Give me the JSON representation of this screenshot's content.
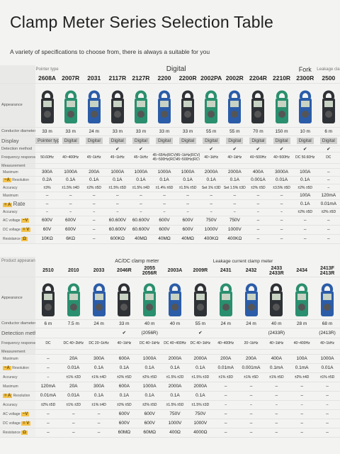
{
  "title": "Clamp Meter Series Selection Table",
  "subtitle": "A variety of specifications to choose from, there is always a suitable for you",
  "p1": {
    "pointer_type": "Pointer type",
    "digital": "Digital",
    "fork": "Fork",
    "fork_note": "Leakage clamp meter",
    "models": [
      "2608A",
      "2007R",
      "2031",
      "2117R",
      "2127R",
      "2200",
      "2200R",
      "2002PA",
      "2002R",
      "2204R",
      "2210R",
      "2300R",
      "2500"
    ],
    "labels": {
      "appearance": "Appearance",
      "conductor": "Conductor diameter",
      "display": "Display",
      "detection": "Detection method",
      "frequency": "Frequency response",
      "measurement": "Measurement",
      "maximum": "Maximum",
      "resolution": "Resolution",
      "accuracy": "Accuracy",
      "maximum2": "Maximum",
      "rate": "Rate",
      "accuracy2": "Accuracy",
      "ac_voltage": "AC voltage",
      "dc_voltage": "DC voltage",
      "resistance": "Resistance",
      "va": "~V",
      "vd": "= V",
      "ohm": "Ω",
      "aa": "~A",
      "ad": "= A"
    },
    "conductor": [
      "33 m",
      "33 m",
      "24 m",
      "33 m",
      "33 m",
      "33 m",
      "33 m",
      "55 m",
      "55 m",
      "70 m",
      "150 m",
      "10 m",
      "6 m"
    ],
    "display": [
      "Pointer type",
      "Digital",
      "Digital",
      "Digital",
      "Digital",
      "Digital",
      "Digital",
      "Digital",
      "Digital",
      "Digital",
      "Digital",
      "Digital",
      "Digital"
    ],
    "detection": [
      "",
      "",
      "",
      "✔",
      "✔",
      "",
      "",
      "✔",
      "✔",
      "✔",
      "✔",
      "✔",
      "✔"
    ],
    "frequency": [
      "50.60Hz",
      "40~400Hz",
      "45~1kHz",
      "45~1kHz",
      "45~1kHz",
      "45~65Hz(RCV) 45~500Hz(RCV)",
      "45~1kHz(RCV) 45~500Hz(RCV)",
      "40~1kHz",
      "40~1kHz",
      "40~500Hz",
      "40~500Hz",
      "DC 50.60Hz",
      "DC"
    ],
    "aac_max": [
      "300A",
      "1000A",
      "200A",
      "1000A",
      "1000A",
      "1000A",
      "1000A",
      "2000A",
      "2000A",
      "400A",
      "3000A",
      "100A",
      "–"
    ],
    "aac_res": [
      "0.2A",
      "0.1A",
      "0.1A",
      "0.1A",
      "0.1A",
      "0.1A",
      "0.1A",
      "0.1A",
      "0.1A",
      "0.001A",
      "0.01A",
      "0.1A",
      "–"
    ],
    "aac_acc": [
      "±3%",
      "±1.5% ±4D",
      "±2% ±5D",
      "±1.5% ±5D",
      "±1.5% ±4D",
      "±1.4% ±6D",
      "±1.5% ±5D",
      "Set 1% ±3D",
      "Set 1.5% ±3D",
      "±2% ±5D",
      "±3.5% ±5D",
      "±2% ±5D",
      "–"
    ],
    "adc_max": [
      "–",
      "–",
      "–",
      "–",
      "–",
      "–",
      "–",
      "–",
      "–",
      "–",
      "–",
      "100A",
      "120mA"
    ],
    "adc_res": [
      "–",
      "–",
      "–",
      "–",
      "–",
      "–",
      "–",
      "–",
      "–",
      "–",
      "–",
      "0.1A",
      "0.01mA"
    ],
    "adc_acc": [
      "–",
      "–",
      "–",
      "–",
      "–",
      "–",
      "–",
      "–",
      "–",
      "–",
      "–",
      "±2% ±5D",
      "±2% ±5D"
    ],
    "vac": [
      "600V",
      "600V",
      "–",
      "60.600V",
      "60.600V",
      "600V",
      "600V",
      "750V",
      "750V",
      "–",
      "–",
      "–",
      "–"
    ],
    "vdc": [
      "60V",
      "600V",
      "–",
      "60.600V",
      "60.600V",
      "600V",
      "600V",
      "1000V",
      "1000V",
      "–",
      "–",
      "–",
      "–"
    ],
    "res": [
      "10KΩ",
      "6KΩ",
      "–",
      "600KΩ",
      "40MΩ",
      "40MΩ",
      "40MΩ",
      "400KΩ",
      "400KΩ",
      "–",
      "–",
      "–",
      "–"
    ]
  },
  "p2": {
    "product": "Product appearance",
    "acdc": "AC/DC clamp meter",
    "leak": "Leakage current clamp meter",
    "models": [
      "2510",
      "2010",
      "2033",
      "2046R",
      "2055 2056R",
      "2003A",
      "2009R",
      "2431",
      "2432",
      "2433 2433R",
      "2434",
      "2413F 2413R"
    ],
    "labels": {
      "appearance": "Appearance",
      "conductor": "Conductor diameter",
      "detection": "Detection method",
      "frequency": "Frequency response",
      "measurement": "Measurement",
      "maximum": "Maximum",
      "resolution": "Resolution",
      "accuracy": "Accuracy",
      "maximum2": "Maximum",
      "resolution2": "Resolution",
      "accuracy2": "Accuracy",
      "ac_voltage": "AC voltage",
      "dc_voltage": "DC voltage",
      "resistance": "Resistance",
      "va": "~V",
      "vd": "= V",
      "ohm": "Ω",
      "aa": "~A",
      "ad": "= A"
    },
    "conductor": [
      "6 m",
      "7.5 m",
      "24 m",
      "33 m",
      "40 m",
      "40 m",
      "55 m",
      "24 m",
      "24 m",
      "40 m",
      "28 m",
      "68 m"
    ],
    "detection": [
      "",
      "",
      "",
      "✔",
      "(2056R)",
      "",
      "✔",
      "",
      "",
      "(2433R)",
      "",
      "(2413R)"
    ],
    "frequency": [
      "DC",
      "DC 40~2kHz",
      "DC 20~1kHz",
      "40~1kHz",
      "DC 40~1kHz",
      "DC 40~400Hz",
      "DC 40~1kHz",
      "40~400Hz",
      "20~1kHz",
      "40~1kHz",
      "40~400Hz",
      "40~1kHz"
    ],
    "aac_max": [
      "–",
      "20A",
      "300A",
      "600A",
      "1000A",
      "2000A",
      "2000A",
      "200A",
      "200A",
      "400A",
      "100A",
      "1000A"
    ],
    "aac_res": [
      "–",
      "0.01A",
      "0.1A",
      "0.1A",
      "0.1A",
      "0.1A",
      "0.1A",
      "0.01mA",
      "0.001mA",
      "0.1mA",
      "0.1mA",
      "0.01A"
    ],
    "aac_acc": [
      "–",
      "±1% ±2D",
      "±1% ±4D",
      "±2% ±5D",
      "±2% ±5D",
      "±1.5% ±2D",
      "±1.5% ±3D",
      "±1% ±3D",
      "±1% ±5D",
      "±1% ±5D",
      "±2% ±4D",
      "±1% ±5D"
    ],
    "adc_max": [
      "120mA",
      "20A",
      "300A",
      "600A",
      "1000A",
      "2000A",
      "2000A",
      "–",
      "–",
      "–",
      "–",
      "–"
    ],
    "adc_res": [
      "0.01mA",
      "0.01A",
      "0.1A",
      "0.1A",
      "0.1A",
      "0.1A",
      "0.1A",
      "–",
      "–",
      "–",
      "–",
      "–"
    ],
    "adc_acc": [
      "±2% ±5D",
      "±1% ±2D",
      "±1% ±4D",
      "±2% ±5D",
      "±2% ±5D",
      "±1.5% ±5D",
      "±1.5% ±3D",
      "–",
      "–",
      "–",
      "–",
      "–"
    ],
    "vac": [
      "–",
      "–",
      "–",
      "600V",
      "600V",
      "750V",
      "750V",
      "–",
      "–",
      "–",
      "–",
      "–"
    ],
    "vdc": [
      "–",
      "–",
      "–",
      "600V",
      "600V",
      "1000V",
      "1000V",
      "–",
      "–",
      "–",
      "–",
      "–"
    ],
    "res": [
      "–",
      "–",
      "–",
      "60MΩ",
      "60MΩ",
      "400Ω",
      "4000Ω",
      "–",
      "–",
      "–",
      "–",
      "–"
    ]
  },
  "colors": {
    "accent": "#f3c24a",
    "device_dark": "#2e3135",
    "device_green": "#2a8f6e",
    "device_blue": "#2b5ca8"
  }
}
